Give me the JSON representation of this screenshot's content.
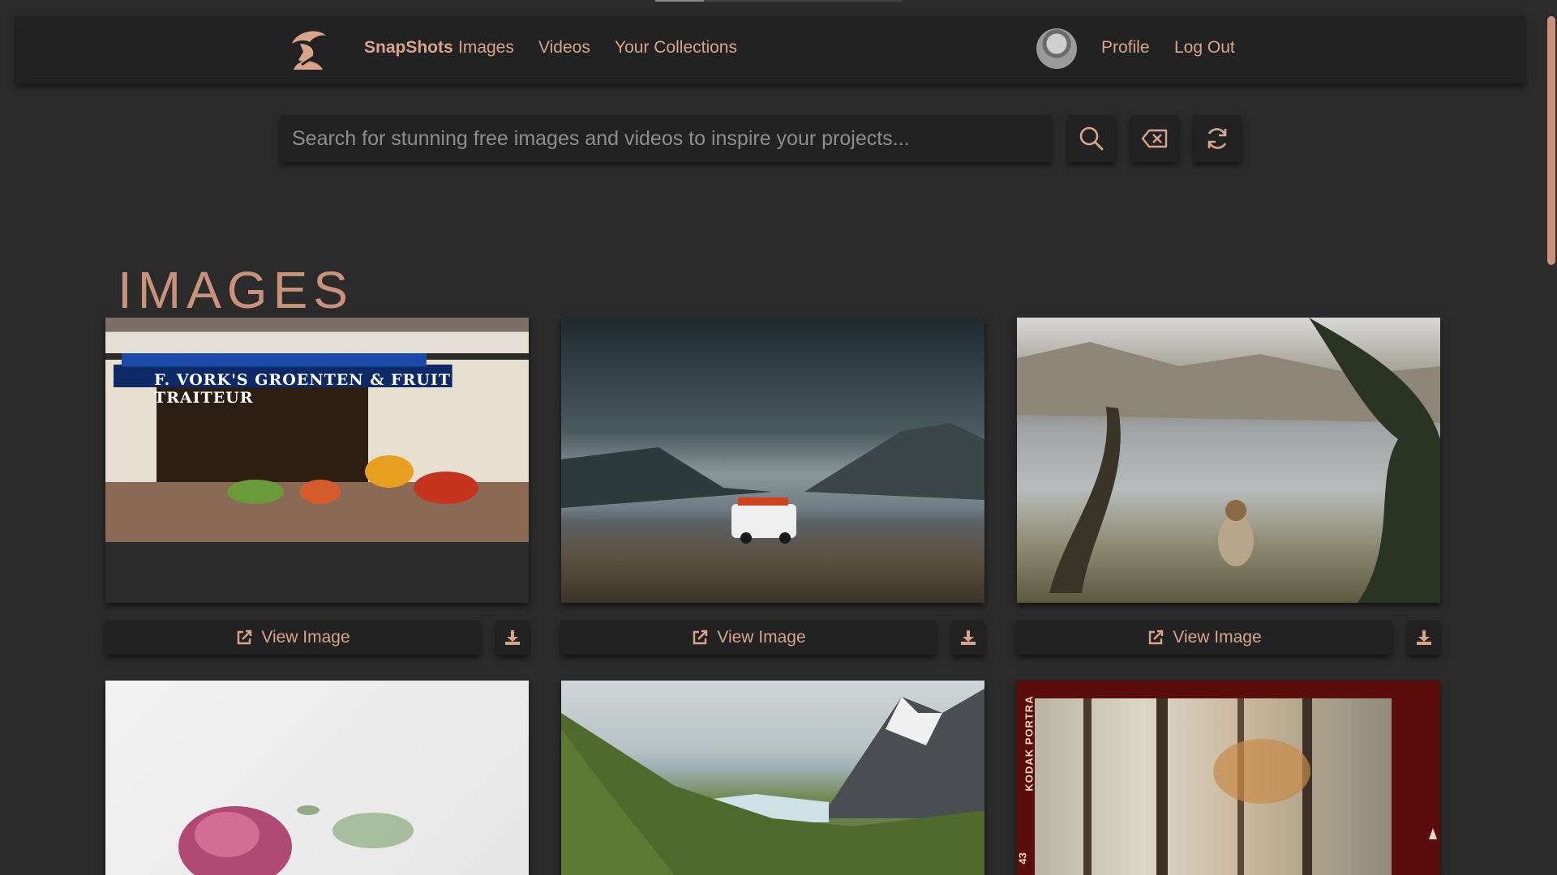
{
  "nav": {
    "brand": "SnapShots",
    "links": [
      "Images",
      "Videos",
      "Your Collections"
    ],
    "profile": "Profile",
    "logout": "Log Out"
  },
  "search": {
    "placeholder": "Search for stunning free images and videos to inspire your projects...",
    "value": ""
  },
  "section": {
    "title": "IMAGES"
  },
  "cards": [
    {
      "view_label": "View Image",
      "shop_sign": "F. VORK'S  GROENTEN & FRUIT  TRAITEUR"
    },
    {
      "view_label": "View Image"
    },
    {
      "view_label": "View Image"
    }
  ],
  "second_row_text": {
    "film_brand": "KODAK PORTRA",
    "film_frame": "43"
  },
  "icons": {
    "logo": "cowboy-hat-person-logo",
    "search": "search-icon",
    "clear": "backspace-clear-icon",
    "refresh": "refresh-icon",
    "view": "external-link-icon",
    "download": "download-icon"
  },
  "colors": {
    "accent": "#d9a58a",
    "background": "#2b2b2b",
    "panel": "#222222"
  }
}
